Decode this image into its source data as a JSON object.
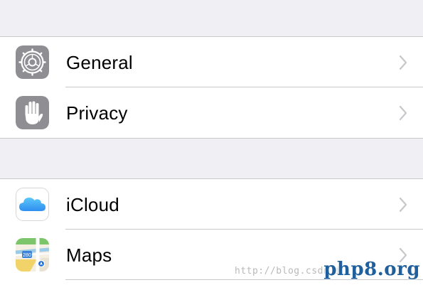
{
  "settings": {
    "groups": [
      {
        "items": [
          {
            "label": "General",
            "icon": "gear-icon"
          },
          {
            "label": "Privacy",
            "icon": "hand-icon"
          }
        ]
      },
      {
        "items": [
          {
            "label": "iCloud",
            "icon": "cloud-icon"
          },
          {
            "label": "Maps",
            "icon": "maps-icon"
          }
        ]
      }
    ]
  },
  "watermark": {
    "url": "http://blog.csdn.i",
    "logo": "php8.org"
  },
  "colors": {
    "background": "#efeff4",
    "separator": "#c8c7cc",
    "gear_icon_bg": "#8e8e93",
    "hand_icon_bg": "#8e8e93",
    "cloud_blue": "#3aa6f5",
    "chevron": "#c7c7cc",
    "logo": "#1f5f9c"
  }
}
